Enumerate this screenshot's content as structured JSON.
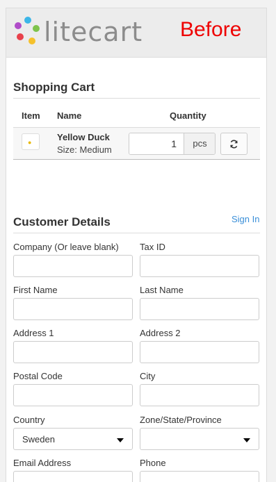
{
  "header": {
    "brand": "litecart",
    "badge": "Before"
  },
  "cart": {
    "title": "Shopping Cart",
    "columns": [
      "Item",
      "Name",
      "Quantity"
    ],
    "item": {
      "name": "Yellow Duck",
      "size": "Size: Medium",
      "quantity": "1",
      "unit": "pcs"
    }
  },
  "customer": {
    "title": "Customer Details",
    "sign_in": "Sign In",
    "fields": {
      "company": {
        "label": "Company (Or leave blank)",
        "value": ""
      },
      "tax_id": {
        "label": "Tax ID",
        "value": ""
      },
      "first_name": {
        "label": "First Name",
        "value": ""
      },
      "last_name": {
        "label": "Last Name",
        "value": ""
      },
      "address1": {
        "label": "Address 1",
        "value": ""
      },
      "address2": {
        "label": "Address 2",
        "value": ""
      },
      "postal_code": {
        "label": "Postal Code",
        "value": ""
      },
      "city": {
        "label": "City",
        "value": ""
      },
      "country": {
        "label": "Country",
        "value": "Sweden"
      },
      "zone": {
        "label": "Zone/State/Province",
        "value": ""
      },
      "email": {
        "label": "Email Address",
        "value": ""
      },
      "phone": {
        "label": "Phone",
        "value": ""
      }
    }
  },
  "colors": {
    "accent": "#3a8fd8",
    "badge": "#ee0000",
    "brand_text": "#8c8c8c"
  },
  "icons": [
    "logo-dots-icon",
    "duck-thumbnail-icon",
    "refresh-icon",
    "chevron-down-icon"
  ]
}
